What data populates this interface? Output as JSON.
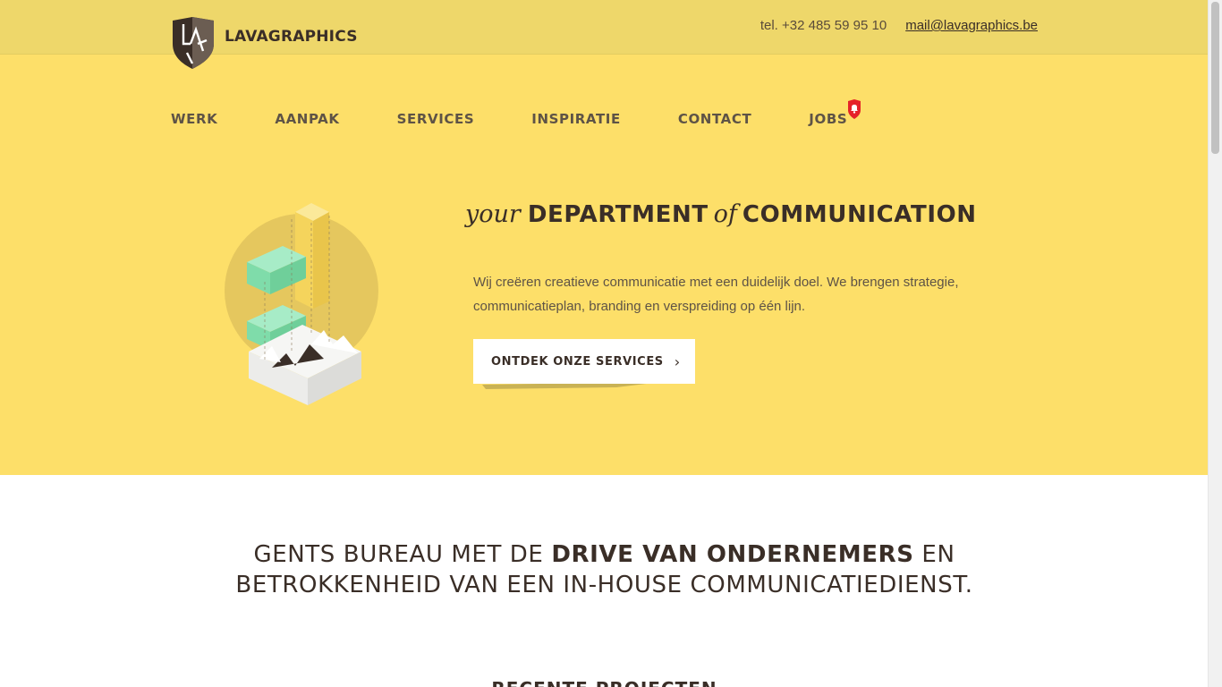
{
  "header": {
    "brand": "LAVAGRAPHICS",
    "phone": "tel. +32 485 59 95 10",
    "email": "mail@lavagraphics.be"
  },
  "nav": {
    "items": [
      "WERK",
      "AANPAK",
      "SERVICES",
      "INSPIRATIE",
      "CONTACT",
      "JOBS"
    ]
  },
  "hero": {
    "headline_script_1": "your",
    "headline_bold_1": "DEPARTMENT",
    "headline_script_2": "of",
    "headline_bold_2": "COMMUNICATION",
    "intro": "Wij creëren creatieve communicatie met een duidelijk doel. We brengen strategie, communicatieplan, branding en verspreiding op één lijn.",
    "cta_label": "ONTDEK ONZE SERVICES"
  },
  "tagline": {
    "part1": "GENTS BUREAU MET DE ",
    "bold": "DRIVE VAN ONDERNEMERS",
    "part2": " EN",
    "line2": "BETROKKENHEID VAN EEN IN-HOUSE COMMUNICATIEDIENST."
  },
  "recent": {
    "title": "RECENTE PROJECTEN"
  },
  "colors": {
    "hero_bg": "#fddf69",
    "topbar_bg": "#eed76a",
    "text_dark": "#3a2e27",
    "badge_red": "#e52229",
    "mint": "#7fdcaa"
  },
  "icons": {
    "logo": "shield-logo-icon",
    "jobs_badge": "bell-icon",
    "cta_arrow": "chevron-right-icon"
  }
}
